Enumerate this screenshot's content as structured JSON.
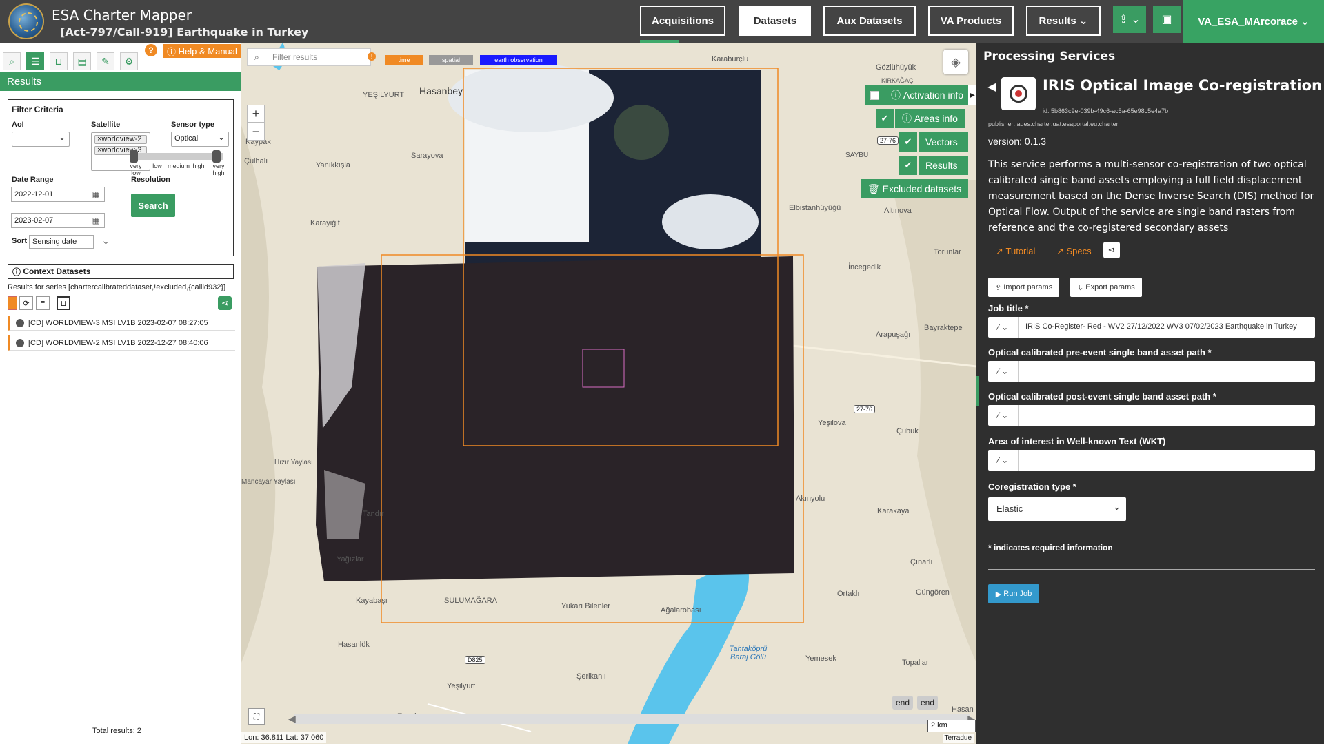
{
  "header": {
    "app_title": "ESA Charter Mapper",
    "activation_title": "[Act-797/Call-919] Earthquake in Turkey",
    "nav": [
      "Acquisitions",
      "Datasets",
      "Aux Datasets",
      "VA Products",
      "Results ⌄"
    ],
    "active_nav": "Datasets",
    "user": "VA_ESA_MArcorace ⌄"
  },
  "left": {
    "help_label": "Help & Manual",
    "results_label": "Results",
    "filter": {
      "title": "Filter Criteria",
      "aoi_label": "AoI",
      "aoi_value": "",
      "satellite_label": "Satellite",
      "satellites": [
        "×worldview-2",
        "×worldview-3"
      ],
      "sensor_label": "Sensor type",
      "sensor_value": "Optical",
      "date_range_label": "Date Range",
      "date_from": "2022-12-01",
      "date_to": "2023-02-07",
      "resolution_label": "Resolution",
      "resolution_ticks": [
        "very low",
        "low",
        "medium",
        "high",
        "very high"
      ],
      "search_label": "Search",
      "sort_label": "Sort",
      "sort_value": "Sensing date"
    },
    "context_title": "Context Datasets",
    "results_subtitle": "Results for series [chartercalibrateddataset,!excluded,{callid932}]",
    "results": [
      "[CD] WORLDVIEW-3 MSI LV1B 2023-02-07 08:27:05",
      "[CD] WORLDVIEW-2 MSI LV1B 2022-12-27 08:40:06"
    ],
    "total_results": "Total results: 2"
  },
  "map": {
    "filter_placeholder": "Filter results",
    "tags": [
      {
        "label": "time",
        "color": "#f08a24"
      },
      {
        "label": "spatial",
        "color": "#999999"
      },
      {
        "label": "earth observation",
        "color": "#1a1aff"
      }
    ],
    "buttons": {
      "activation_info": "Activation info",
      "areas_info": "Areas info",
      "vectors": "Vectors",
      "results": "Results",
      "excluded": "Excluded datasets"
    },
    "places": [
      "Karaburçlu",
      "Gözlühüyük",
      "Hasanbey",
      "YEŞİLYURT",
      "Kaypak",
      "Çulhalı",
      "Sarayova",
      "Yanıkkışla",
      "Karayiğit",
      "Elbistanhüyüğü",
      "Altınova",
      "KIRKAĞAÇ",
      "SAYBU",
      "Torunlar",
      "İncegedik",
      "Arapuşağı",
      "Bayraktepe",
      "Yeşilova",
      "Çubuk",
      "Hızır Yaylası",
      "Mancayar Yaylası",
      "Akınyolu",
      "Karakaya",
      "Tandır",
      "Yağızlar",
      "Çınarlı",
      "Güngören",
      "Kayabaşı",
      "SULUMAĞARA",
      "Yukarı Bilenler",
      "Ağalarobası",
      "Ortaklı",
      "Hasanlök",
      "Tahtaköprü Baraj Gölü",
      "Yemesek",
      "Topallar",
      "Şerikanlı",
      "Yeşilyurt",
      "Hasan",
      "Esenler"
    ],
    "road_tags": [
      "27-76",
      "27-76",
      "D825"
    ],
    "end_labels": [
      "end",
      "end"
    ],
    "scale": "2 km",
    "coords": "Lon: 36.811 Lat: 37.060",
    "attribution": "Terradue"
  },
  "panel": {
    "title": "Processing Services",
    "service_name": "IRIS Optical Image Co-registration",
    "service_id": "id: 5b863c9e-039b-49c6-ac5a-65e98c5e4a7b",
    "publisher": "publisher: ades.charter.uat.esaportal.eu.charter",
    "version": "version: 0.1.3",
    "description": "This service performs a multi-sensor co-registration of two optical calibrated single band assets employing a full field displacement measurement based on the Dense Inverse Search (DIS) method for Optical Flow. Output of the service are single band rasters from reference and the co-registered secondary assets",
    "tutorial": "Tutorial",
    "specs": "Specs",
    "import_params": "Import params",
    "export_params": "Export params",
    "fields": [
      {
        "label": "Job title *",
        "value": "IRIS Co-Register- Red - WV2 27/12/2022 WV3 07/02/2023 Earthquake in Turkey"
      },
      {
        "label": "Optical calibrated pre-event single band asset path *",
        "value": ""
      },
      {
        "label": "Optical calibrated post-event single band asset path *",
        "value": ""
      },
      {
        "label": "Area of interest in Well-known Text (WKT)",
        "value": ""
      }
    ],
    "coreg_label": "Coregistration type *",
    "coreg_value": "Elastic",
    "required_note": "* indicates required information",
    "run_job": "Run Job"
  }
}
